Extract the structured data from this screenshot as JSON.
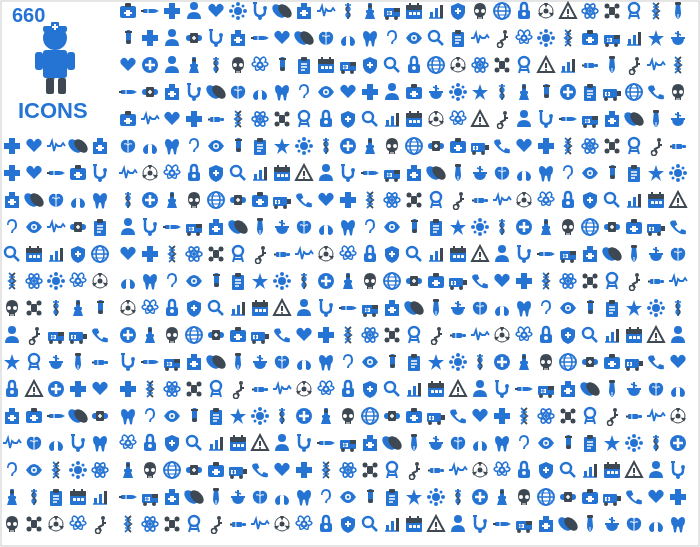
{
  "title": "660 IcONS",
  "header": {
    "number": "660",
    "icons_label": "ICONS"
  },
  "colors": {
    "blue": "#2574d4",
    "dark": "#3d4852",
    "white": "#ffffff"
  },
  "description": "660 medical and healthcare icon set displayed in a grid"
}
